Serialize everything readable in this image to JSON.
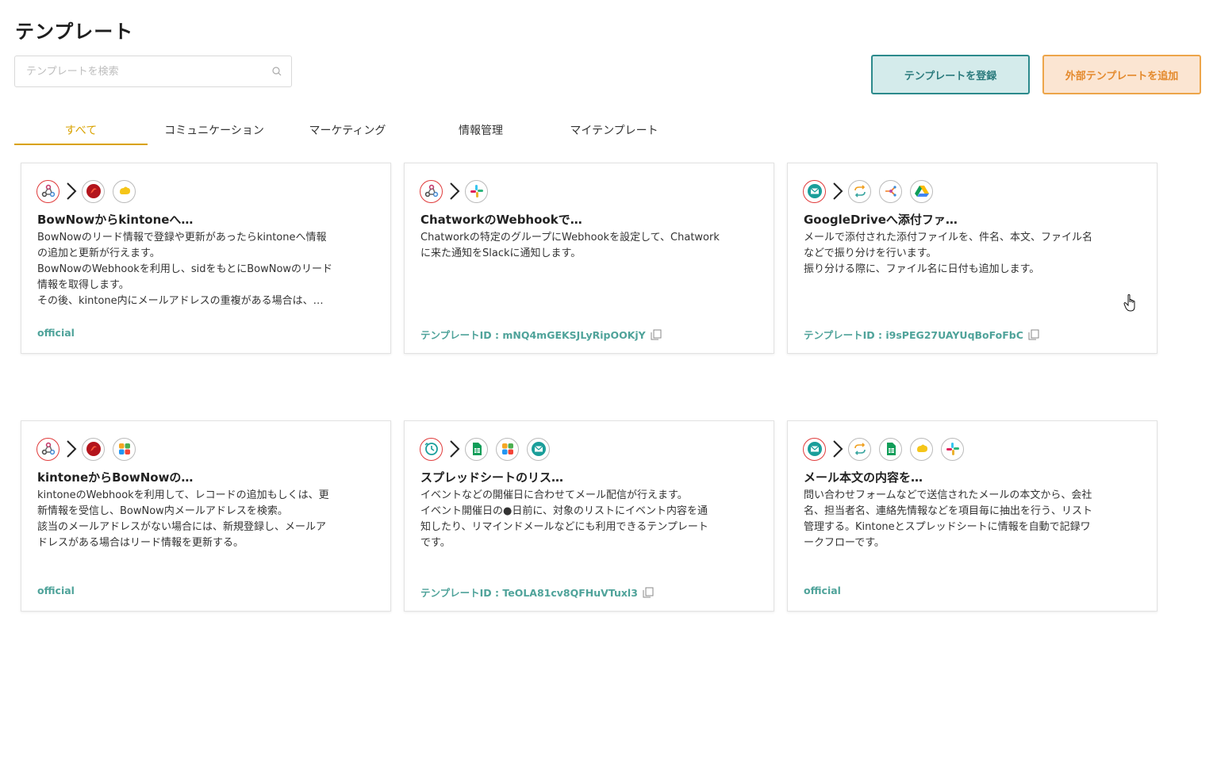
{
  "page": {
    "title": "テンプレート"
  },
  "search": {
    "placeholder": "テンプレートを検索",
    "value": ""
  },
  "buttons": {
    "register": "テンプレートを登録",
    "external": "外部テンプレートを追加"
  },
  "tabs": [
    {
      "label": "すべて",
      "active": true
    },
    {
      "label": "コミュニケーション",
      "active": false
    },
    {
      "label": "マーケティング",
      "active": false
    },
    {
      "label": "情報管理",
      "active": false
    },
    {
      "label": "マイテンプレート",
      "active": false
    }
  ],
  "cards": [
    {
      "title": "BowNowからkintoneへ…",
      "description": "BowNowのリード情報で登録や更新があったらkintoneへ情報\nの追加と更新が行えます。\nBowNowのWebhookを利用し、sidをもとにBowNowのリード\n情報を取得します。\nその後、kintone内にメールアドレスの重複がある場合は、…",
      "footer": "official",
      "icons": [
        "webhook-icon",
        "chevron-right-icon",
        "bownow-icon",
        "kintone-icon"
      ]
    },
    {
      "title": "ChatworkのWebhookで…",
      "description": "Chatworkの特定のグループにWebhookを設定して、Chatwork\nに来た通知をSlackに通知します。",
      "footer": "テンプレートID : mNQ4mGEKSJLyRipOOKjY",
      "icons": [
        "webhook-icon",
        "chevron-right-icon",
        "slack-icon"
      ]
    },
    {
      "title": "GoogleDriveへ添付ファ…",
      "description": "メールで添付された添付ファイルを、件名、本文、ファイル名\nなどで振り分けを行います。\n振り分ける際に、ファイル名に日付も追加します。",
      "footer": "テンプレートID : i9sPEG27UAYUqBoFoFbC",
      "icons": [
        "mail-icon",
        "chevron-right-icon",
        "loop-icon",
        "branch-icon",
        "google-drive-icon"
      ]
    },
    {
      "title": "kintoneからBowNowの…",
      "description": "kintoneのWebhookを利用して、レコードの追加もしくは、更\n新情報を受信し、BowNow内メールアドレスを検索。\n該当のメールアドレスがない場合には、新規登録し、メールア\nドレスがある場合はリード情報を更新する。",
      "footer": "official",
      "icons": [
        "webhook-icon",
        "chevron-right-icon",
        "bownow-icon",
        "grid-app-icon"
      ]
    },
    {
      "title": "スプレッドシートのリス…",
      "description": "イベントなどの開催日に合わせてメール配信が行えます。\nイベント開催日の●日前に、対象のリストにイベント内容を通\n知したり、リマインドメールなどにも利用できるテンプレート\nです。",
      "footer": "テンプレートID : TeOLA81cv8QFHuVTuxl3",
      "icons": [
        "schedule-icon",
        "chevron-right-icon",
        "google-sheets-icon",
        "grid-app-icon",
        "mail-icon"
      ]
    },
    {
      "title": "メール本文の内容を…",
      "description": "問い合わせフォームなどで送信されたメールの本文から、会社\n名、担当者名、連絡先情報などを項目毎に抽出を行う、リスト\n管理する。Kintoneとスプレッドシートに情報を自動で記録ワ\nークフローです。",
      "footer": "official",
      "icons": [
        "mail-icon",
        "chevron-right-icon",
        "loop-icon",
        "google-sheets-icon",
        "kintone-icon",
        "slack-icon"
      ]
    }
  ],
  "colors": {
    "accent": "#d9a200",
    "register_bg": "#d4ebeb",
    "register_border": "#2c8a8c",
    "external_bg": "#fbe5d2",
    "external_border": "#eda54a",
    "footer_text": "#4fa39a"
  }
}
